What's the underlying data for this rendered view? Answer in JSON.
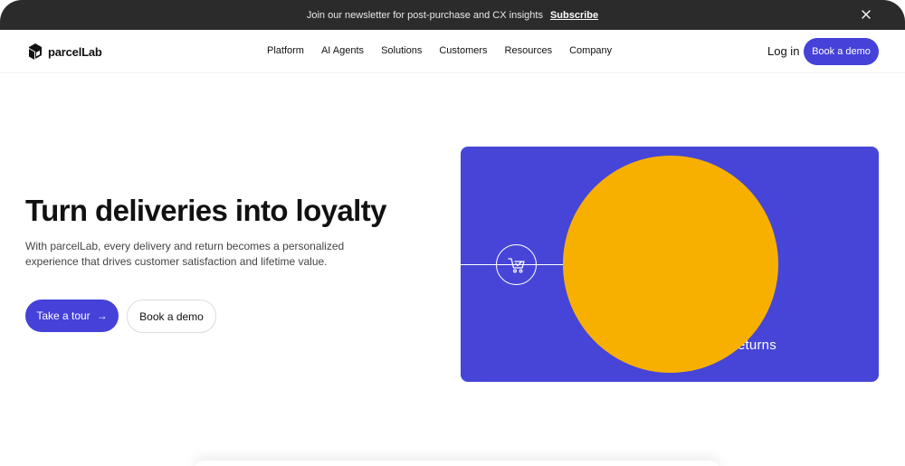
{
  "announcement": {
    "message": "Join our newsletter for post-purchase and CX insights",
    "link": "Subscribe"
  },
  "nav": {
    "logo": "parcelLab",
    "items": [
      {
        "label": "Platform"
      },
      {
        "label": "AI Agents"
      },
      {
        "label": "Solutions"
      },
      {
        "label": "Customers"
      },
      {
        "label": "Resources"
      },
      {
        "label": "Company"
      }
    ],
    "login": "Log in",
    "cta": "Book a demo"
  },
  "hero": {
    "title": "Turn deliveries into loyalty",
    "description": "With parcelLab, every delivery and return becomes a personalized experience that drives customer satisfaction and lifetime value.",
    "primary_button": "Take a tour",
    "primary_arrow": "→",
    "secondary_button": "Book a demo"
  },
  "visual": {
    "partial_label": "eturns"
  },
  "colors": {
    "accent": "#4541d9",
    "visual_bg": "#4645d8",
    "circle": "#f8b000",
    "topbar": "#2b2b2b"
  }
}
